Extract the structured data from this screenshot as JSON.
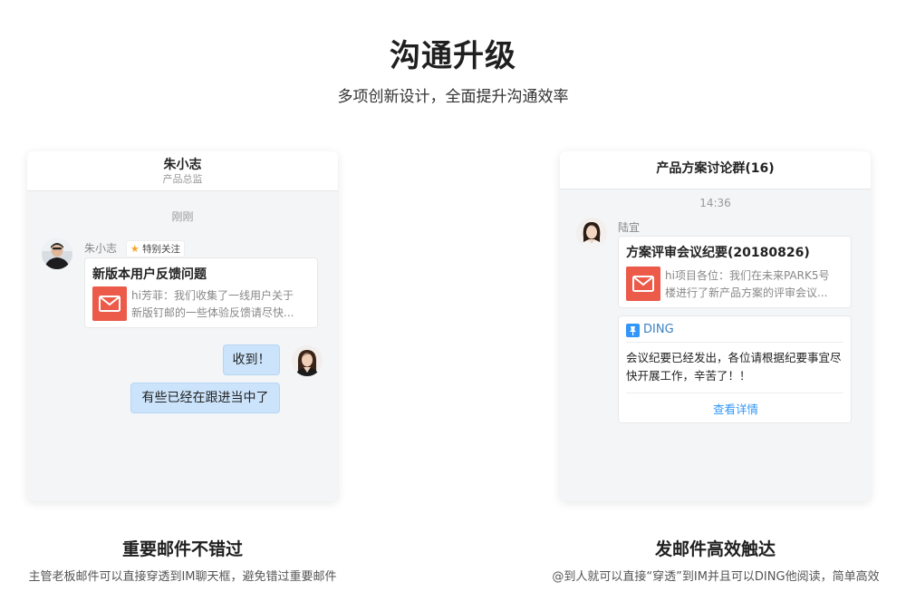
{
  "hero": {
    "title": "沟通升级",
    "subtitle": "多项创新设计，全面提升沟通效率"
  },
  "left_chat": {
    "header_name": "朱小志",
    "header_role": "产品总监",
    "timestamp": "刚刚",
    "sender_name": "朱小志",
    "badge_label": "特别关注",
    "mail_title": "新版本用户反馈问题",
    "mail_preview_line1": "hi芳菲：我们收集了一线用户关于",
    "mail_preview_line2": "新版钉邮的一些体验反馈请尽快...",
    "reply_1": "收到！",
    "reply_2": "有些已经在跟进当中了"
  },
  "right_chat": {
    "header_title": "产品方案讨论群(16)",
    "timestamp": "14:36",
    "sender_name": "陆宜",
    "mail_title": "方案评审会议纪要(20180826)",
    "mail_preview_line1": "hi项目各位：我们在未来PARK5号",
    "mail_preview_line2": "楼进行了新产品方案的评审会议...",
    "ding_label": "DING",
    "ding_text_line1": "会议纪要已经发出，各位请根据纪要事宜尽",
    "ding_text_line2": "快开展工作，辛苦了！！",
    "ding_link": "查看详情"
  },
  "features": {
    "left_title": "重要邮件不错过",
    "left_desc": "主管老板邮件可以直接穿透到IM聊天框，避免错过重要邮件",
    "right_title": "发邮件高效触达",
    "right_desc": "@到人就可以直接“穿透”到IM并且可以DING他阅读，简单高效"
  },
  "colors": {
    "mail_icon": "#ec5a4a",
    "bubble": "#cce4fb",
    "link": "#3296fa",
    "star": "#f5a623"
  }
}
